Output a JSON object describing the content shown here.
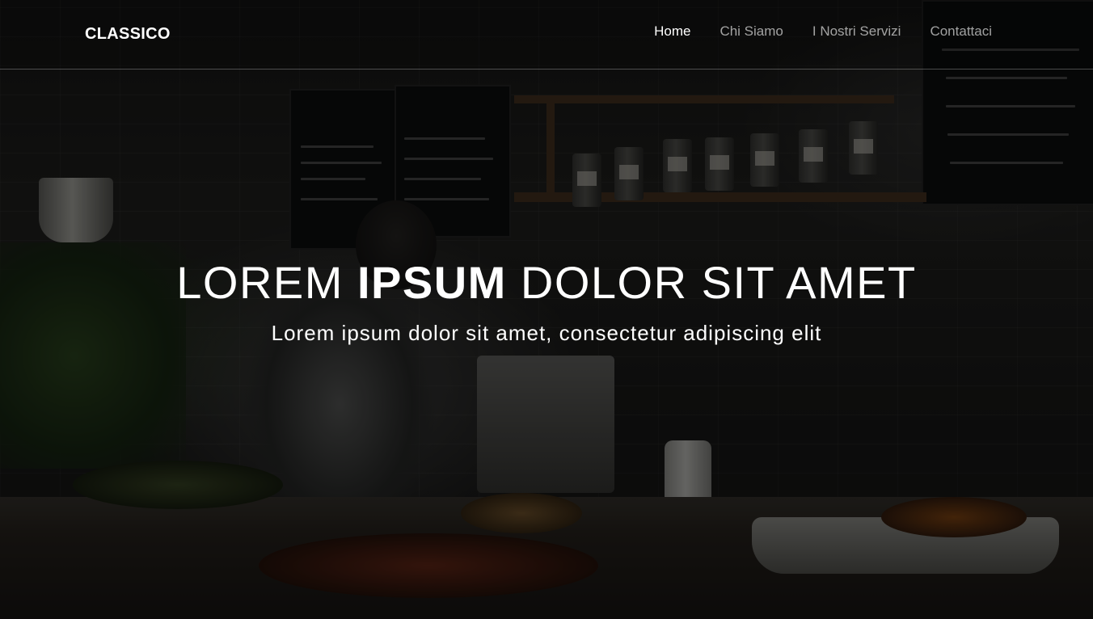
{
  "navbar": {
    "brand": "CLASSICO",
    "links": [
      {
        "label": "Home",
        "active": true
      },
      {
        "label": "Chi Siamo",
        "active": false
      },
      {
        "label": "I Nostri Servizi",
        "active": false
      },
      {
        "label": "Contattaci",
        "active": false
      }
    ]
  },
  "hero": {
    "title_part1": "LOREM",
    "title_bold": "IPSUM",
    "title_part2": "DOLOR SIT AMET",
    "subtitle": "Lorem ipsum dolor sit amet, consectetur adipiscing elit"
  },
  "colors": {
    "text": "#ffffff",
    "nav_inactive": "#9e9e9e",
    "overlay": "#000000"
  }
}
